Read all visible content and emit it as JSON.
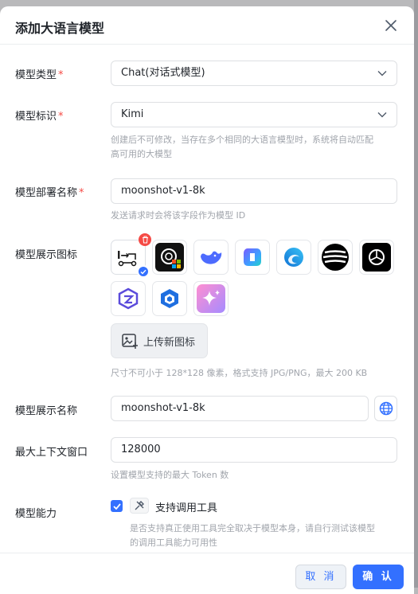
{
  "dialog": {
    "title": "添加大语言模型",
    "close_icon": "close-icon"
  },
  "form": {
    "model_type": {
      "label": "模型类型",
      "required": "*",
      "value": "Chat(对话式模型)"
    },
    "model_id": {
      "label": "模型标识",
      "required": "*",
      "value": "Kimi",
      "hint_line1": "创建后不可修改，当存在多个相同的大语言模型时，系统将自动匹配",
      "hint_line2": "高可用的大模型"
    },
    "deploy_name": {
      "label": "模型部署名称",
      "required": "*",
      "value": "moonshot-v1-8k",
      "hint": "发送请求时会将该字段作为模型 ID"
    },
    "display_icon": {
      "label": "模型展示图标",
      "icons": [
        "kimi-logo-icon",
        "office-openai-icon",
        "deepseek-whale-icon",
        "copilot-icon",
        "edge-swirl-icon",
        "striped-sphere-icon",
        "openai-icon",
        "tongyi-qwen-icon",
        "hexagon-cube-icon",
        "gradient-sparkle-icon"
      ],
      "upload_label": "上传新图标",
      "hint": "尺寸不可小于 128*128 像素，格式支持 JPG/PNG，最大 200 KB"
    },
    "display_name": {
      "label": "模型展示名称",
      "value": "moonshot-v1-8k"
    },
    "context_window": {
      "label": "最大上下文窗口",
      "value": "128000",
      "hint": "设置模型支持的最大 Token 数"
    },
    "capability": {
      "label": "模型能力",
      "option_label": "支持调用工具",
      "checked": true,
      "hint_line1": "是否支持真正使用工具完全取决于模型本身，请自行测试该模型",
      "hint_line2": "的调用工具能力可用性"
    }
  },
  "footer": {
    "cancel_label": "取 消",
    "ok_label": "确 认"
  },
  "colors": {
    "primary": "#3370ff",
    "required": "#f54a45",
    "hint": "#a1a5ac"
  }
}
